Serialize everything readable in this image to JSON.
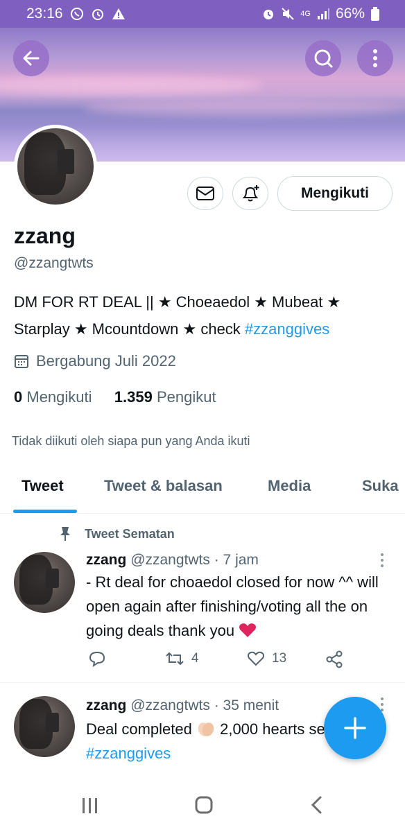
{
  "status_bar": {
    "time": "23:16",
    "network": "4G",
    "battery": "66%"
  },
  "profile": {
    "name": "zzang",
    "handle": "@zzangtwts",
    "bio_text": "DM FOR RT DEAL || ★ Choeaedol ★ Mubeat ★ Starplay ★ Mcountdown ★ check ",
    "bio_hashtag": "#zzanggives",
    "joined": "Bergabung Juli 2022",
    "following_count": "0",
    "following_label": "Mengikuti",
    "followers_count": "1.359",
    "followers_label": "Pengikut",
    "not_followed_text": "Tidak diikuti oleh siapa pun yang Anda ikuti",
    "follow_button_label": "Mengikuti"
  },
  "tabs": [
    {
      "label": "Tweet",
      "active": true
    },
    {
      "label": "Tweet & balasan",
      "active": false
    },
    {
      "label": "Media",
      "active": false
    },
    {
      "label": "Suka",
      "active": false
    }
  ],
  "pinned_label": "Tweet Sematan",
  "tweets": [
    {
      "name": "zzang",
      "handle": "@zzangtwts",
      "time": "· 7 jam",
      "text": "- Rt deal for choaedol closed for now ^^ will open again after finishing/voting all the on going deals thank you ",
      "retweets": "4",
      "likes": "13"
    },
    {
      "name": "zzang",
      "handle": "@zzangtwts",
      "time": "· 35 menit",
      "text_before": "Deal completed ",
      "text_after": " 2,000 hearts seventeen!",
      "hashtag": "#zzanggives"
    }
  ],
  "colors": {
    "accent": "#1d9bf0",
    "status_bar": "#7f5fbf",
    "heart": "#e0245e"
  }
}
